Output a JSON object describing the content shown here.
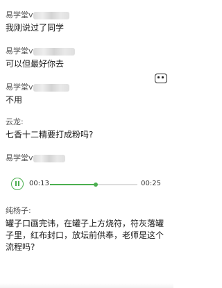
{
  "messages": [
    {
      "sender": "易学堂v",
      "text": "我刚说过了同学"
    },
    {
      "sender": "易学堂v",
      "text": "可以但最好你去"
    },
    {
      "sender": "易学堂v",
      "text": "不用"
    },
    {
      "sender": "云龙:",
      "text": "七香十二精要打成粉吗?"
    },
    {
      "sender": "易学堂v",
      "text": ""
    },
    {
      "sender": "纯杨子:",
      "text": "罐子口画完讳，在罐子上方烧符，符灰落罐子里，红布封口，放坛前供奉，老师是这个流程吗?"
    }
  ],
  "voice": {
    "current_time": "00:13",
    "total_time": "00:25",
    "progress": 0.52
  },
  "icons": {
    "play_pause": "pause-icon",
    "side": "floating-window-icon"
  },
  "colors": {
    "accent": "#4caf50",
    "text": "#1a1a1a",
    "sender": "#555555"
  }
}
